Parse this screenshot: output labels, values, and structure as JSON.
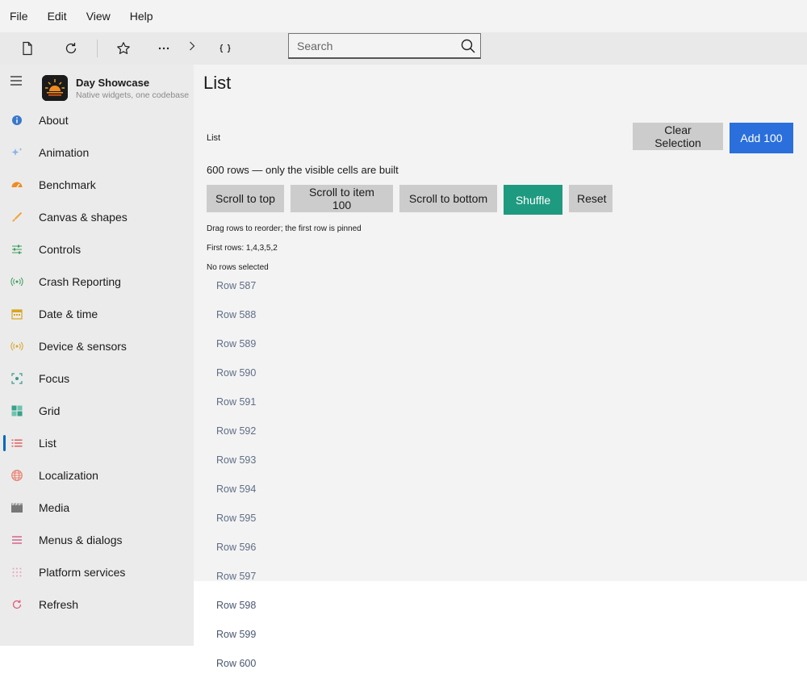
{
  "menubar": {
    "items": [
      "File",
      "Edit",
      "View",
      "Help"
    ]
  },
  "toolbar": {
    "buttons": [
      {
        "name": "new-page-icon"
      },
      {
        "name": "refresh-icon"
      },
      {
        "name": "star-icon"
      },
      {
        "name": "more-icon"
      },
      {
        "name": "chevron-right-icon"
      },
      {
        "name": "brackets-icon"
      }
    ],
    "search_placeholder": "Search"
  },
  "app": {
    "title": "Day Showcase",
    "subtitle": "Native widgets, one codebase"
  },
  "sidebar": {
    "items": [
      {
        "label": "About",
        "icon": "info-icon",
        "color": "#3a78c9"
      },
      {
        "label": "Animation",
        "icon": "sparkle-icon",
        "color": "#8ab4e8"
      },
      {
        "label": "Benchmark",
        "icon": "gauge-icon",
        "color": "#f08a24"
      },
      {
        "label": "Canvas & shapes",
        "icon": "brush-icon",
        "color": "#f2a33a"
      },
      {
        "label": "Controls",
        "icon": "sliders-icon",
        "color": "#3b9c5a"
      },
      {
        "label": "Crash Reporting",
        "icon": "broadcast-icon",
        "color": "#3b9c5a"
      },
      {
        "label": "Date & time",
        "icon": "calendar-icon",
        "color": "#d9a520"
      },
      {
        "label": "Device & sensors",
        "icon": "sensor-icon",
        "color": "#d9a520"
      },
      {
        "label": "Focus",
        "icon": "focus-icon",
        "color": "#3a9a8a"
      },
      {
        "label": "Grid",
        "icon": "grid-icon",
        "color": "#3aa08a"
      },
      {
        "label": "List",
        "icon": "list-icon",
        "color": "#e05555",
        "selected": true
      },
      {
        "label": "Localization",
        "icon": "globe-icon",
        "color": "#e87a6a"
      },
      {
        "label": "Media",
        "icon": "clapper-icon",
        "color": "#777777"
      },
      {
        "label": "Menus & dialogs",
        "icon": "menu-lines-icon",
        "color": "#d04a7a"
      },
      {
        "label": "Platform services",
        "icon": "dots-grid-icon",
        "color": "#e07a9a"
      },
      {
        "label": "Refresh",
        "icon": "refresh-icon",
        "color": "#e05577"
      }
    ]
  },
  "main": {
    "title": "List",
    "list_label": "List",
    "clear_selection": "Clear Selection",
    "add_100": "Add 100",
    "info": "600 rows — only the visible cells are built",
    "actions": {
      "scroll_top": "Scroll to top",
      "scroll_item": "Scroll to item 100",
      "scroll_bottom": "Scroll to bottom",
      "shuffle": "Shuffle",
      "reset": "Reset"
    },
    "drag_hint": "Drag rows to reorder; the first row is pinned",
    "first_rows": "First rows: 1,4,3,5,2",
    "selection_status": "No rows selected",
    "rows": [
      "Row 587",
      "Row 588",
      "Row 589",
      "Row 590",
      "Row 591",
      "Row 592",
      "Row 593",
      "Row 594",
      "Row 595",
      "Row 596",
      "Row 597",
      "Row 598",
      "Row 599",
      "Row 600"
    ]
  },
  "colors": {
    "accent_blue": "#2a6fdb",
    "shuffle_green": "#1e9a80",
    "selection_indicator": "#0067c0"
  }
}
